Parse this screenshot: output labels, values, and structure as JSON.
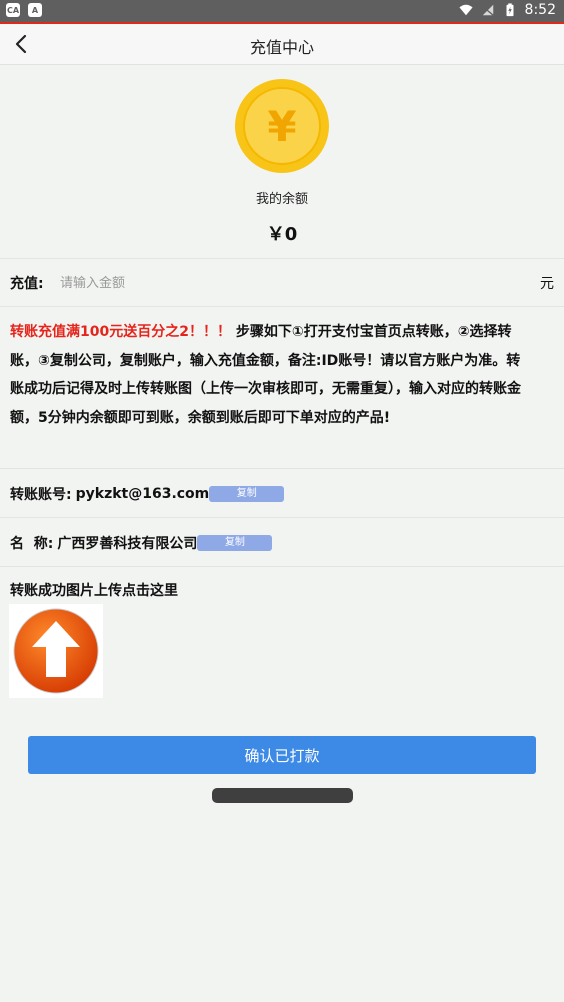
{
  "status_bar": {
    "left_icons": [
      "CA",
      "A"
    ],
    "time": "8:52",
    "icons": [
      "wifi-icon",
      "signal-icon",
      "battery-icon"
    ]
  },
  "header": {
    "title": "充值中心",
    "back_icon": "chevron-left-icon"
  },
  "balance": {
    "coin_symbol": "¥",
    "label": "我的余额",
    "value": "￥0"
  },
  "recharge": {
    "label": "充值:",
    "placeholder": "请输入金额",
    "value": "",
    "unit": "元"
  },
  "notice": {
    "highlight": "转账充值满100元送百分之2！！！",
    "body": "步骤如下①打开支付宝首页点转账，②选择转账，③复制公司，复制账户，输入充值金额，备注:ID账号！请以官方账户为准。转账成功后记得及时上传转账图（上传一次审核即可，无需重复），输入对应的转账金额，5分钟内余额即可到账，余额到账后即可下单对应的产品!"
  },
  "account": {
    "label": "转账账号:",
    "value": "pykzkt@163.com",
    "copy_label": "复制"
  },
  "company": {
    "label": "名  称:",
    "value": "广西罗善科技有限公司",
    "copy_label": "复制"
  },
  "upload": {
    "title": "转账成功图片上传点击这里",
    "icon": "upload-arrow-icon"
  },
  "confirm": {
    "label": "确认已打款"
  },
  "colors": {
    "accent": "#3d89e6",
    "highlight": "#e5241b",
    "coin": "#f8c417",
    "copy_button": "#8fa9e7"
  }
}
